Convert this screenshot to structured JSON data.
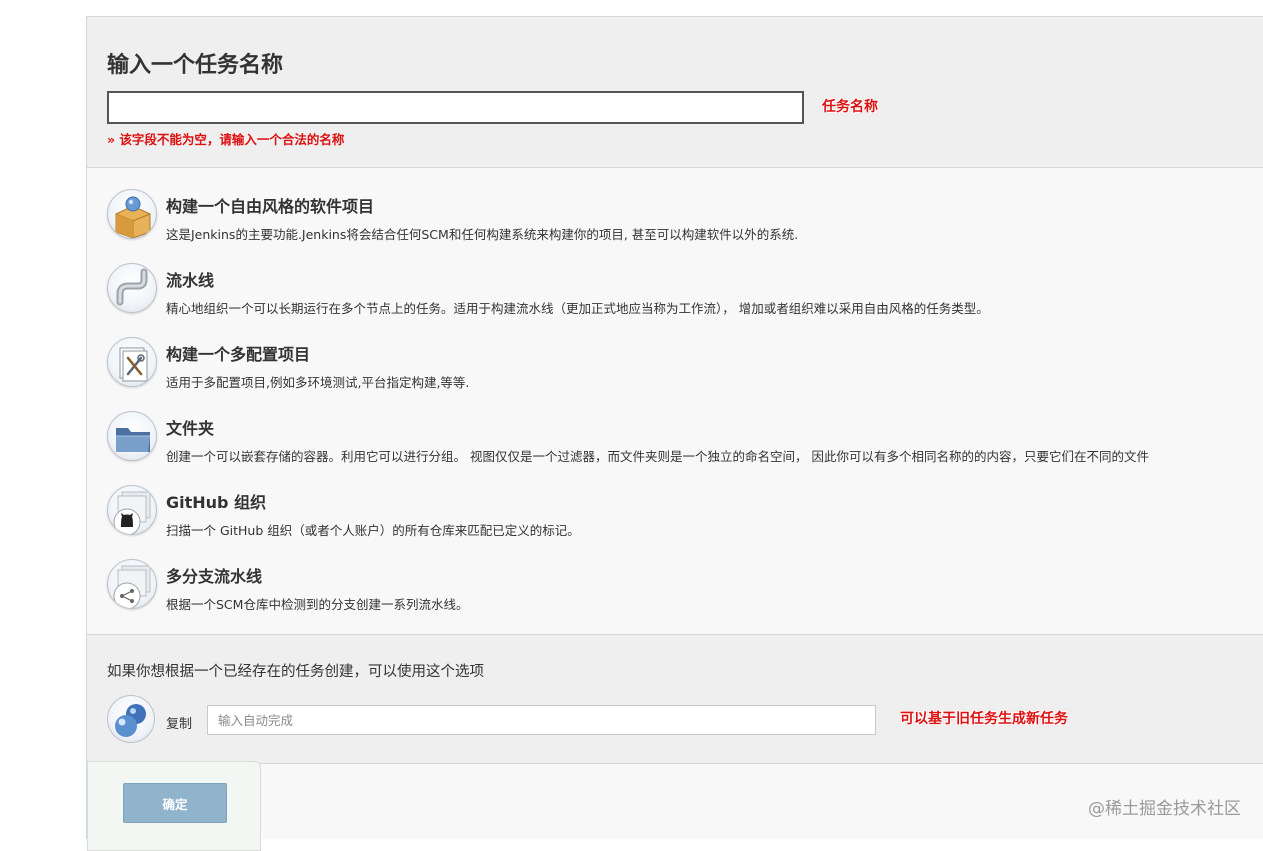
{
  "form": {
    "title": "输入一个任务名称",
    "name_value": "",
    "name_annotation": "任务名称",
    "error": "» 该字段不能为空，请输入一个合法的名称"
  },
  "items": [
    {
      "icon": "package-box-icon",
      "title": "构建一个自由风格的软件项目",
      "desc": "这是Jenkins的主要功能.Jenkins将会结合任何SCM和任何构建系统来构建你的项目, 甚至可以构建软件以外的系统."
    },
    {
      "icon": "pipeline-icon",
      "title": "流水线",
      "desc": "精心地组织一个可以长期运行在多个节点上的任务。适用于构建流水线（更加正式地应当称为工作流）， 增加或者组织难以采用自由风格的任务类型。"
    },
    {
      "icon": "multi-config-icon",
      "title": "构建一个多配置项目",
      "desc": "适用于多配置项目,例如多环境测试,平台指定构建,等等."
    },
    {
      "icon": "folder-icon",
      "title": "文件夹",
      "desc": "创建一个可以嵌套存储的容器。利用它可以进行分组。 视图仅仅是一个过滤器，而文件夹则是一个独立的命名空间， 因此你可以有多个相同名称的的内容，只要它们在不同的文件"
    },
    {
      "icon": "github-org-icon",
      "title": "GitHub 组织",
      "desc": "扫描一个 GitHub 组织（或者个人账户）的所有仓库来匹配已定义的标记。"
    },
    {
      "icon": "multibranch-icon",
      "title": "多分支流水线",
      "desc": "根据一个SCM仓库中检测到的分支创建一系列流水线。"
    }
  ],
  "copy": {
    "heading": "如果你想根据一个已经存在的任务创建，可以使用这个选项",
    "label": "复制",
    "placeholder": "输入自动完成",
    "annotation": "可以基于旧任务生成新任务"
  },
  "footer": {
    "ok_label": "确定"
  },
  "watermark": "@稀土掘金技术社区"
}
